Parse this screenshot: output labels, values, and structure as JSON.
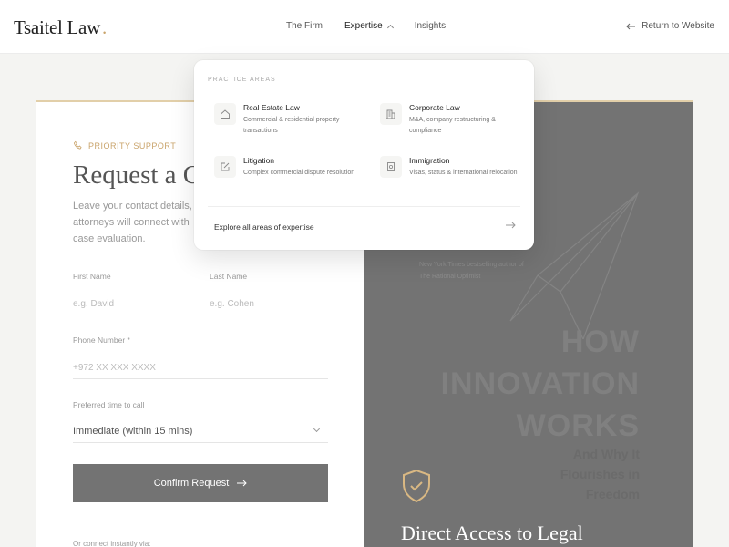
{
  "header": {
    "logo": "Tsaitel Law",
    "logo_dot": ".",
    "nav": [
      "The Firm",
      "Expertise",
      "Insights"
    ],
    "return_label": "Return to Website"
  },
  "form": {
    "badge": "PRIORITY SUPPORT",
    "title": "Request a C",
    "description": "Leave your contact details, attorneys will connect with case evaluation.",
    "first_name": {
      "label": "First Name",
      "placeholder": "e.g. David"
    },
    "last_name": {
      "label": "Last Name",
      "placeholder": "e.g. Cohen"
    },
    "phone": {
      "label": "Phone Number *",
      "placeholder": "+972 XX XXX XXXX"
    },
    "time": {
      "label": "Preferred time to call",
      "value": "Immediate (within 15 mins)"
    },
    "submit_label": "Confirm Request",
    "connect_label": "Or connect instantly via:"
  },
  "panel": {
    "book_author": [
      "New York Times bestselling author of",
      "The Rational Optimist"
    ],
    "book_title": [
      "HOW",
      "INNOVATION",
      "WORKS"
    ],
    "book_subtitle": [
      "And Why It",
      "Flourishes in",
      "Freedom"
    ],
    "headline": "Direct Access to Legal"
  },
  "dropdown": {
    "heading": "PRACTICE AREAS",
    "areas": [
      {
        "name": "Real Estate Law",
        "desc": "Commercial & residential property transactions",
        "icon": "home-icon"
      },
      {
        "name": "Corporate Law",
        "desc": "M&A, company restructuring & compliance",
        "icon": "building-icon"
      },
      {
        "name": "Litigation",
        "desc": "Complex commercial dispute resolution",
        "icon": "edit-icon"
      },
      {
        "name": "Immigration",
        "desc": "Visas, status & international relocation",
        "icon": "passport-icon"
      }
    ],
    "explore_label": "Explore all areas of expertise"
  },
  "colors": {
    "accent": "#c9a36a",
    "button": "#737373",
    "panel": "#737373"
  }
}
